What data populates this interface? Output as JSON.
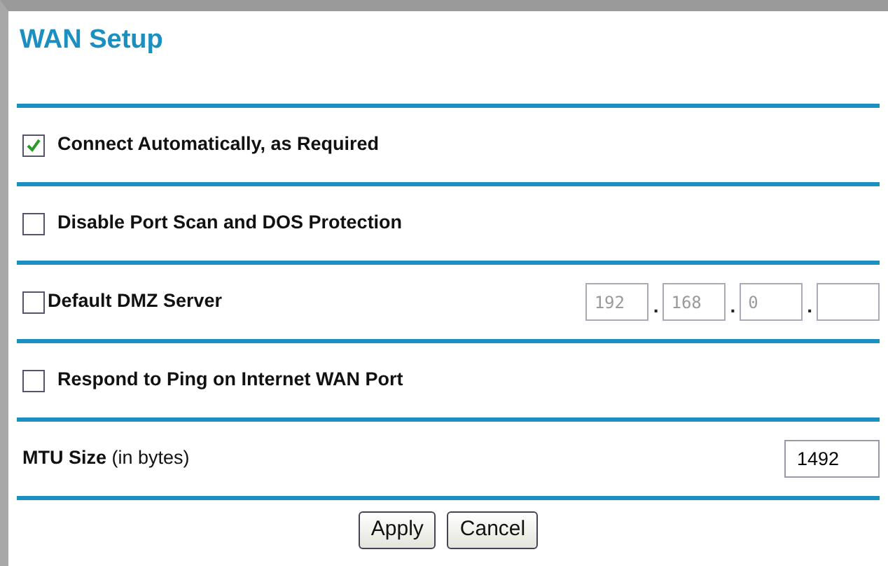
{
  "title": "WAN Setup",
  "rows": [
    {
      "kind": "checkbox",
      "label": "Connect Automatically, as Required",
      "checked": true
    },
    {
      "kind": "checkbox",
      "label": "Disable Port Scan and DOS Protection",
      "checked": false
    },
    {
      "kind": "ip",
      "label": "Default DMZ Server",
      "checked": false,
      "disabled": true,
      "octets": [
        {
          "kind": "octet",
          "value": "192"
        },
        {
          "kind": "octet",
          "value": "168"
        },
        {
          "kind": "octet",
          "value": "0"
        },
        {
          "kind": "octet"
        }
      ],
      "separator": "."
    },
    {
      "kind": "checkbox",
      "label": "Respond to Ping on Internet WAN Port",
      "checked": false
    },
    {
      "kind": "text",
      "label": "**MTU Size** (in bytes)",
      "value": "1492"
    }
  ],
  "buttons": [
    "Apply",
    "Cancel"
  ]
}
